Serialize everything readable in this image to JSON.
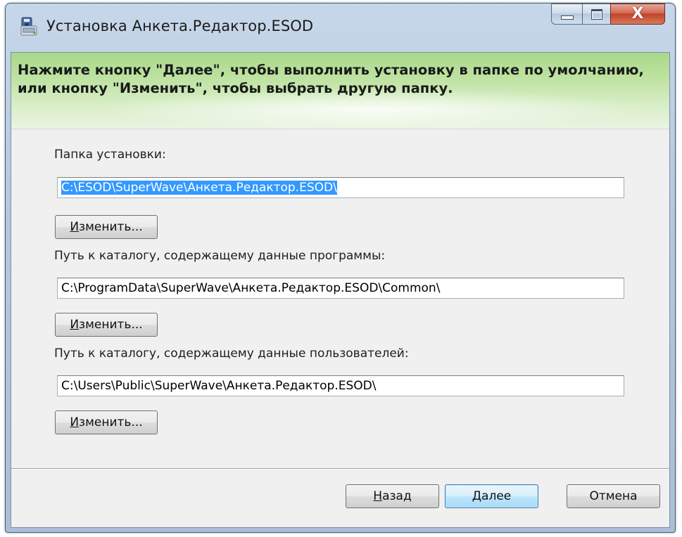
{
  "window": {
    "title": "Установка Анкета.Редактор.ESOD",
    "close_glyph": "X"
  },
  "banner": {
    "text_line1": "Нажмите кнопку \"Далее\", чтобы выполнить установку в папке по умолчанию,",
    "text_line2": "или кнопку \"Изменить\", чтобы выбрать другую папку."
  },
  "install_folder": {
    "label": "Папка установки:",
    "value": "C:\\ESOD\\SuperWave\\Анкета.Редактор.ESOD\\",
    "change_first": "И",
    "change_rest": "зменить..."
  },
  "program_data": {
    "label": "Путь к каталогу, содержащему данные программы:",
    "value": "C:\\ProgramData\\SuperWave\\Анкета.Редактор.ESOD\\Common\\",
    "change_first": "И",
    "change_rest": "зменить..."
  },
  "user_data": {
    "label": "Путь к каталогу, содержащему данные пользователей:",
    "value": "C:\\Users\\Public\\SuperWave\\Анкета.Редактор.ESOD\\",
    "change_first": "И",
    "change_rest": "зменить..."
  },
  "footer": {
    "back_first": "Н",
    "back_rest": "азад",
    "next_first": "Д",
    "next_rest": "алее",
    "cancel": "Отмена"
  },
  "colors": {
    "selection": "#3399ff",
    "banner_green": "#bfe3a3",
    "close_red": "#c0432a"
  }
}
